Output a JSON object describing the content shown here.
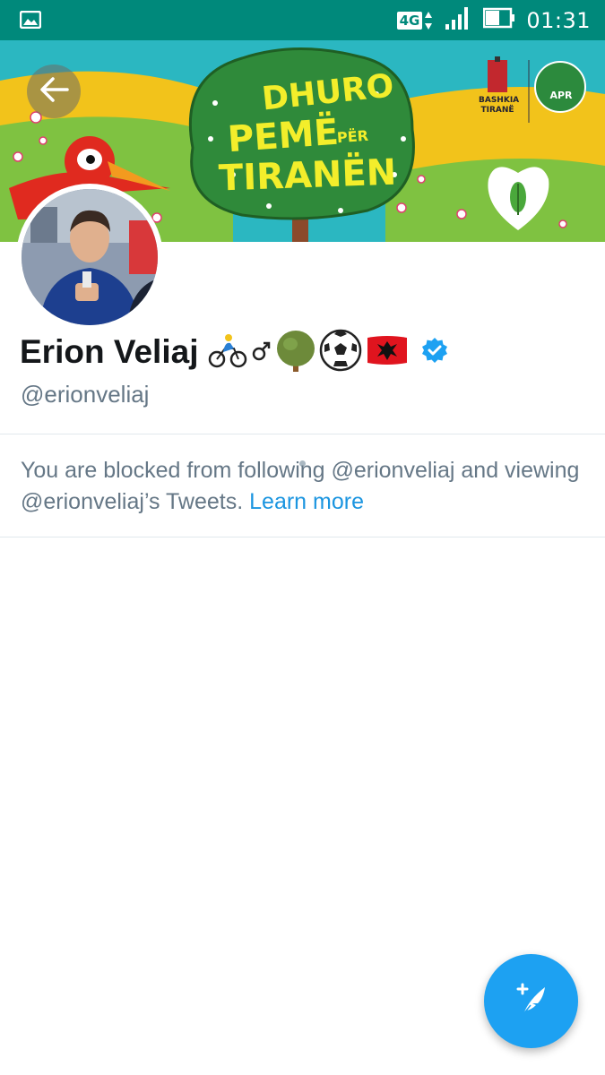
{
  "status_bar": {
    "network": "4G",
    "time": "01:31",
    "icons": [
      "image-notification-icon",
      "network-arrows-icon",
      "signal-icon",
      "battery-icon"
    ]
  },
  "banner": {
    "line1": "DHURO",
    "line2": "PEMË",
    "per": "PËR",
    "line3": "TIRANËN",
    "logo_left_line1": "BASHKIA",
    "logo_left_line2": "TIRANË",
    "logo_right": "APR",
    "colors": {
      "sky": "#2bb7c1",
      "yellow": "#f2c31b",
      "grass": "#7fc241",
      "tree": "#2f8a3a",
      "text": "#f3ee2b"
    }
  },
  "profile": {
    "name": "Erion Veliaj",
    "emoji_icons": [
      "cyclist-icon",
      "male-sign-icon",
      "tree-icon",
      "soccer-ball-icon",
      "albania-flag-icon"
    ],
    "verified": true,
    "handle": "@erionveliaj"
  },
  "blocked": {
    "message": "You are blocked from following @erionveliaj and viewing @erionveliaj’s Tweets.",
    "link": "Learn more"
  },
  "fab": {
    "icon": "compose-tweet-icon"
  },
  "colors": {
    "status_bar": "#00897b",
    "accent": "#1da1f2",
    "link": "#1b95e0",
    "secondary_text": "#657786",
    "primary_text": "#14171a"
  }
}
